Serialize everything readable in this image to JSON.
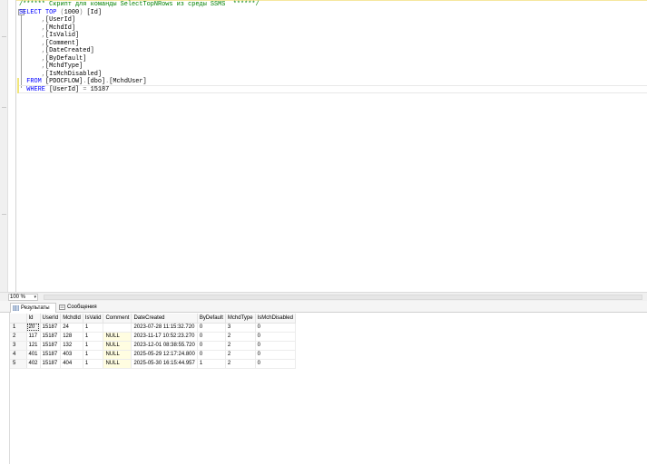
{
  "editor": {
    "lines": [
      {
        "parts": [
          {
            "c": "cm",
            "t": "/****** Скрипт для команды SelectTopNRows из среды SSMS  ******/"
          }
        ]
      },
      {
        "parts": [
          {
            "c": "kw",
            "t": "SELECT "
          },
          {
            "c": "kw",
            "t": "TOP "
          },
          {
            "c": "gy",
            "t": "("
          },
          {
            "c": "tx",
            "t": "1000"
          },
          {
            "c": "gy",
            "t": ") "
          },
          {
            "c": "tx",
            "t": "[Id]"
          }
        ]
      },
      {
        "parts": [
          {
            "c": "gy",
            "t": "      ,"
          },
          {
            "c": "tx",
            "t": "[UserId]"
          }
        ]
      },
      {
        "parts": [
          {
            "c": "gy",
            "t": "      ,"
          },
          {
            "c": "tx",
            "t": "[MchdId]"
          }
        ]
      },
      {
        "parts": [
          {
            "c": "gy",
            "t": "      ,"
          },
          {
            "c": "tx",
            "t": "[IsValid]"
          }
        ]
      },
      {
        "parts": [
          {
            "c": "gy",
            "t": "      ,"
          },
          {
            "c": "tx",
            "t": "[Comment]"
          }
        ]
      },
      {
        "parts": [
          {
            "c": "gy",
            "t": "      ,"
          },
          {
            "c": "tx",
            "t": "[DateCreated]"
          }
        ]
      },
      {
        "parts": [
          {
            "c": "gy",
            "t": "      ,"
          },
          {
            "c": "tx",
            "t": "[ByDefault]"
          }
        ]
      },
      {
        "parts": [
          {
            "c": "gy",
            "t": "      ,"
          },
          {
            "c": "tx",
            "t": "[MchdType]"
          }
        ]
      },
      {
        "parts": [
          {
            "c": "gy",
            "t": "      ,"
          },
          {
            "c": "tx",
            "t": "[IsMchDisabled]"
          }
        ]
      },
      {
        "parts": [
          {
            "c": "kw",
            "t": "  FROM "
          },
          {
            "c": "tx",
            "t": "[PDOCFLOW]"
          },
          {
            "c": "gy",
            "t": "."
          },
          {
            "c": "tx",
            "t": "[dbo]"
          },
          {
            "c": "gy",
            "t": "."
          },
          {
            "c": "tx",
            "t": "[MchdUser]"
          }
        ]
      },
      {
        "parts": [
          {
            "c": "kw",
            "t": "  WHERE "
          },
          {
            "c": "tx",
            "t": "[UserId] "
          },
          {
            "c": "gy",
            "t": "= "
          },
          {
            "c": "tx",
            "t": "15187"
          }
        ]
      }
    ]
  },
  "zoom": {
    "value": "100 %",
    "arrow": "▾"
  },
  "tabs": {
    "results": "Результаты",
    "messages": "Сообщения"
  },
  "grid": {
    "columns": [
      "Id",
      "UserId",
      "MchdId",
      "IsValid",
      "Comment",
      "DateCreated",
      "ByDefault",
      "MchdType",
      "IsMchDisabled"
    ],
    "rows": [
      {
        "rn": "1",
        "cells": [
          "20",
          "15187",
          "24",
          "1",
          "",
          "2023-07-28 11:15:32.720",
          "0",
          "3",
          "0"
        ]
      },
      {
        "rn": "2",
        "cells": [
          "117",
          "15187",
          "128",
          "1",
          "NULL",
          "2023-11-17 10:52:23.270",
          "0",
          "2",
          "0"
        ]
      },
      {
        "rn": "3",
        "cells": [
          "121",
          "15187",
          "132",
          "1",
          "NULL",
          "2023-12-01 08:38:55.720",
          "0",
          "2",
          "0"
        ]
      },
      {
        "rn": "4",
        "cells": [
          "401",
          "15187",
          "403",
          "1",
          "NULL",
          "2025-05-29 12:17:24.800",
          "0",
          "2",
          "0"
        ]
      },
      {
        "rn": "5",
        "cells": [
          "402",
          "15187",
          "404",
          "1",
          "NULL",
          "2025-05-30 16:15:44.957",
          "1",
          "2",
          "0"
        ]
      }
    ]
  },
  "colors": {
    "keyword": "#0000ff",
    "comment": "#008000",
    "operator": "#808080",
    "null_bg": "#fffde1"
  }
}
